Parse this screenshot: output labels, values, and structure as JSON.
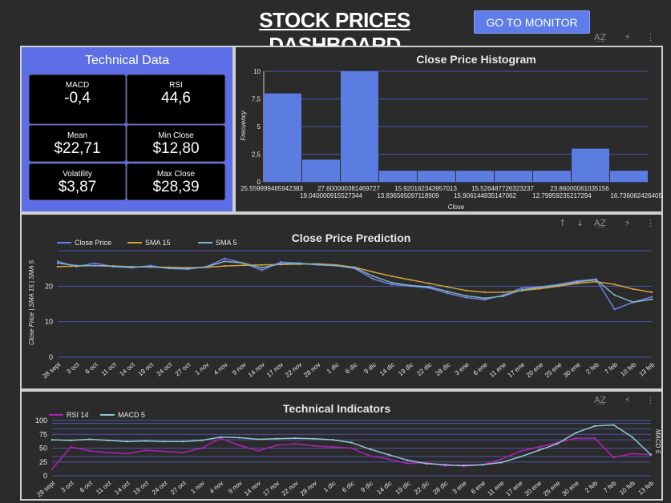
{
  "header": {
    "title": "STOCK PRICES DASHBOARD",
    "monitor_button": "GO TO MONITOR"
  },
  "toolbar_icons": [
    "sort-az-icon",
    "lightning-icon",
    "more-vert-icon",
    "arrow-up-icon",
    "arrow-down-icon"
  ],
  "colors": {
    "background": "#2b2b2b",
    "accent": "#5c6ee6",
    "bar": "#5b7ce0",
    "close_price": "#6f7fe8",
    "sma15": "#d4a13a",
    "sma5": "#7fb4c4",
    "rsi": "#b21fb2",
    "macd": "#8fc9cf"
  },
  "technical_data": {
    "title": "Technical Data",
    "cards": [
      {
        "label": "MACD",
        "value": "-0,4"
      },
      {
        "label": "RSI",
        "value": "44,6"
      },
      {
        "label": "Mean",
        "value": "$22,71"
      },
      {
        "label": "Min Close",
        "value": "$12,80"
      },
      {
        "label": "Volatility",
        "value": "$3,87"
      },
      {
        "label": "Max Close",
        "value": "$28,39"
      }
    ]
  },
  "chart_data": [
    {
      "type": "bar",
      "title": "Close Price Histogram",
      "ylabel": "Frecuency",
      "xlabel": "Close",
      "ylim": [
        0,
        10
      ],
      "yticks": [
        "0",
        "2,5",
        "5",
        "7,5",
        "10"
      ],
      "categories": [
        "25.559999465942383",
        "19.040000915527344",
        "27.600000381469727",
        "13.836565097118909",
        "15.920162343957013",
        "15.906144835147062",
        "15.526487726323237",
        "12.79959235217294",
        "23.86000061035156",
        "16.736062426405..."
      ],
      "values": [
        8,
        2,
        10,
        1,
        1,
        1,
        1,
        1,
        3,
        1
      ]
    },
    {
      "type": "line",
      "title": "Close Price Prediction",
      "ylabel": "Close Price | SMA 15 | SMA 5",
      "ylim": [
        0,
        30
      ],
      "yticks": [
        "0",
        "10",
        "20"
      ],
      "x": [
        "28 sept",
        "3 oct",
        "6 oct",
        "11 oct",
        "14 oct",
        "19 oct",
        "24 oct",
        "27 oct",
        "1 nov",
        "4 nov",
        "9 nov",
        "14 nov",
        "17 nov",
        "22 nov",
        "28 nov",
        "1 dic",
        "6 dic",
        "9 dic",
        "14 dic",
        "19 dic",
        "22 dic",
        "28 dic",
        "3 ene",
        "6 ene",
        "11 ene",
        "17 ene",
        "20 ene",
        "25 ene",
        "30 ene",
        "2 feb",
        "7 feb",
        "10 feb",
        "13 feb"
      ],
      "series": [
        {
          "name": "Close Price",
          "values": [
            27,
            25.5,
            26.5,
            25.5,
            25.2,
            25.8,
            25,
            24.8,
            25.5,
            27.8,
            26.5,
            24.5,
            26.8,
            26.5,
            26,
            25.8,
            25,
            22,
            20.5,
            20,
            19.5,
            18,
            16.8,
            16.2,
            17.5,
            19.5,
            19.8,
            20.5,
            21.5,
            22,
            13.5,
            15.5,
            17
          ]
        },
        {
          "name": "SMA 15",
          "values": [
            25.5,
            25.7,
            25.8,
            25.7,
            25.5,
            25.4,
            25.3,
            25.2,
            25.3,
            25.7,
            25.9,
            26,
            26.1,
            26.2,
            26.3,
            26,
            25.3,
            24,
            22.8,
            21.8,
            20.8,
            19.8,
            18.8,
            18.3,
            18.3,
            18.8,
            19.3,
            20,
            20.8,
            21.3,
            20.5,
            19.2,
            18.3
          ]
        },
        {
          "name": "SMA 5",
          "values": [
            26.5,
            25.8,
            25.8,
            25.6,
            25.4,
            25.5,
            25.1,
            25,
            25.4,
            27,
            26.5,
            25.2,
            26.3,
            26.4,
            26.1,
            25.8,
            25.2,
            22.8,
            21,
            20.2,
            19.8,
            18.5,
            17.3,
            16.6,
            17.2,
            19,
            19.7,
            20.3,
            21.2,
            21.8,
            17.5,
            15.5,
            16.3
          ]
        }
      ]
    },
    {
      "type": "line",
      "title": "Technical Indicators",
      "ylabel": "MACD 5",
      "ylim": [
        0,
        100
      ],
      "yticks": [
        "0",
        "25",
        "50",
        "75",
        "100"
      ],
      "x": [
        "28 sept",
        "3 oct",
        "6 oct",
        "11 oct",
        "14 oct",
        "19 oct",
        "24 oct",
        "27 oct",
        "1 nov",
        "4 nov",
        "9 nov",
        "14 nov",
        "17 nov",
        "22 nov",
        "28 nov",
        "1 dic",
        "6 dic",
        "9 dic",
        "14 dic",
        "19 dic",
        "22 dic",
        "28 dic",
        "3 ene",
        "6 ene",
        "11 ene",
        "17 ene",
        "20 ene",
        "25 ene",
        "30 ene",
        "2 feb",
        "7 feb",
        "10 feb",
        "13 feb"
      ],
      "series": [
        {
          "name": "RSI 14",
          "values": [
            12,
            52,
            45,
            42,
            40,
            46,
            44,
            42,
            50,
            68,
            55,
            45,
            55,
            58,
            54,
            52,
            50,
            36,
            30,
            22,
            24,
            18,
            20,
            20,
            30,
            44,
            52,
            60,
            68,
            68,
            33,
            40,
            38
          ]
        },
        {
          "name": "MACD 5",
          "values": [
            65,
            64,
            66,
            64,
            62,
            63,
            62,
            62,
            64,
            70,
            69,
            66,
            67,
            68,
            67,
            65,
            60,
            48,
            38,
            28,
            22,
            20,
            18,
            20,
            24,
            34,
            46,
            58,
            78,
            90,
            92,
            70,
            38
          ]
        }
      ]
    }
  ]
}
